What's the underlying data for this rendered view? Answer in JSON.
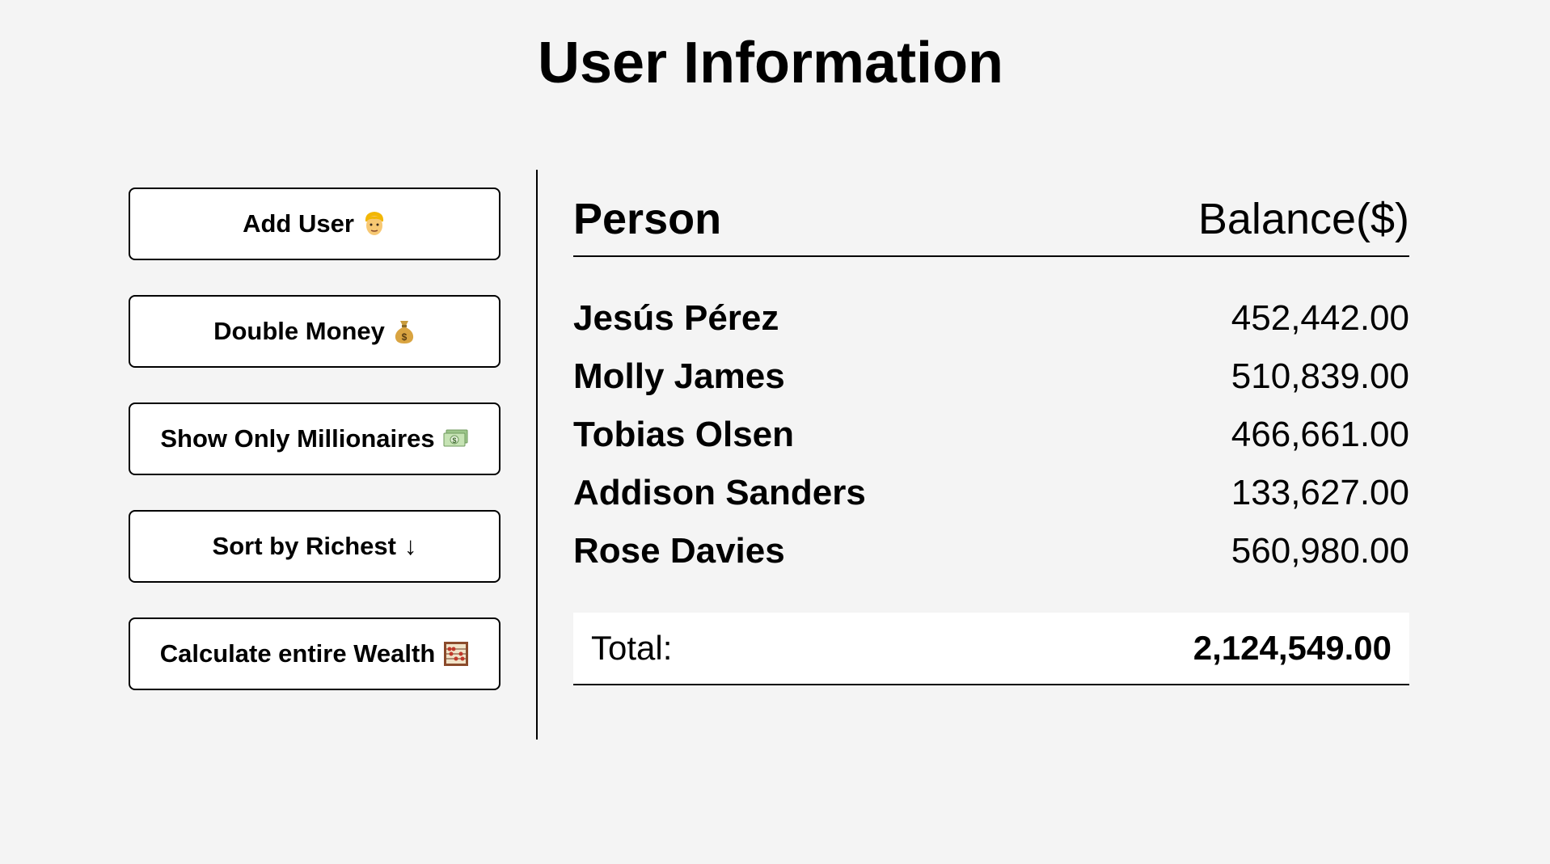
{
  "page": {
    "title": "User Information"
  },
  "controls": {
    "buttons": [
      {
        "label": "Add User",
        "icon": "man-blond-icon"
      },
      {
        "label": "Double Money",
        "icon": "money-bag-icon"
      },
      {
        "label": "Show Only Millionaires",
        "icon": "dollar-banknote-icon"
      },
      {
        "label": "Sort by Richest",
        "icon": "down-arrow-glyph",
        "glyph": "↓"
      },
      {
        "label": "Calculate entire Wealth",
        "icon": "abacus-icon"
      }
    ]
  },
  "table": {
    "headers": {
      "person": "Person",
      "balance": "Balance($)"
    },
    "rows": [
      {
        "name": "Jesús Pérez",
        "balance": "452,442.00"
      },
      {
        "name": "Molly James",
        "balance": "510,839.00"
      },
      {
        "name": "Tobias Olsen",
        "balance": "466,661.00"
      },
      {
        "name": "Addison Sanders",
        "balance": "133,627.00"
      },
      {
        "name": "Rose Davies",
        "balance": "560,980.00"
      }
    ],
    "total": {
      "label": "Total:",
      "value": "2,124,549.00"
    }
  },
  "colors": {
    "background": "#f4f4f4",
    "card": "#ffffff",
    "text": "#000000"
  }
}
